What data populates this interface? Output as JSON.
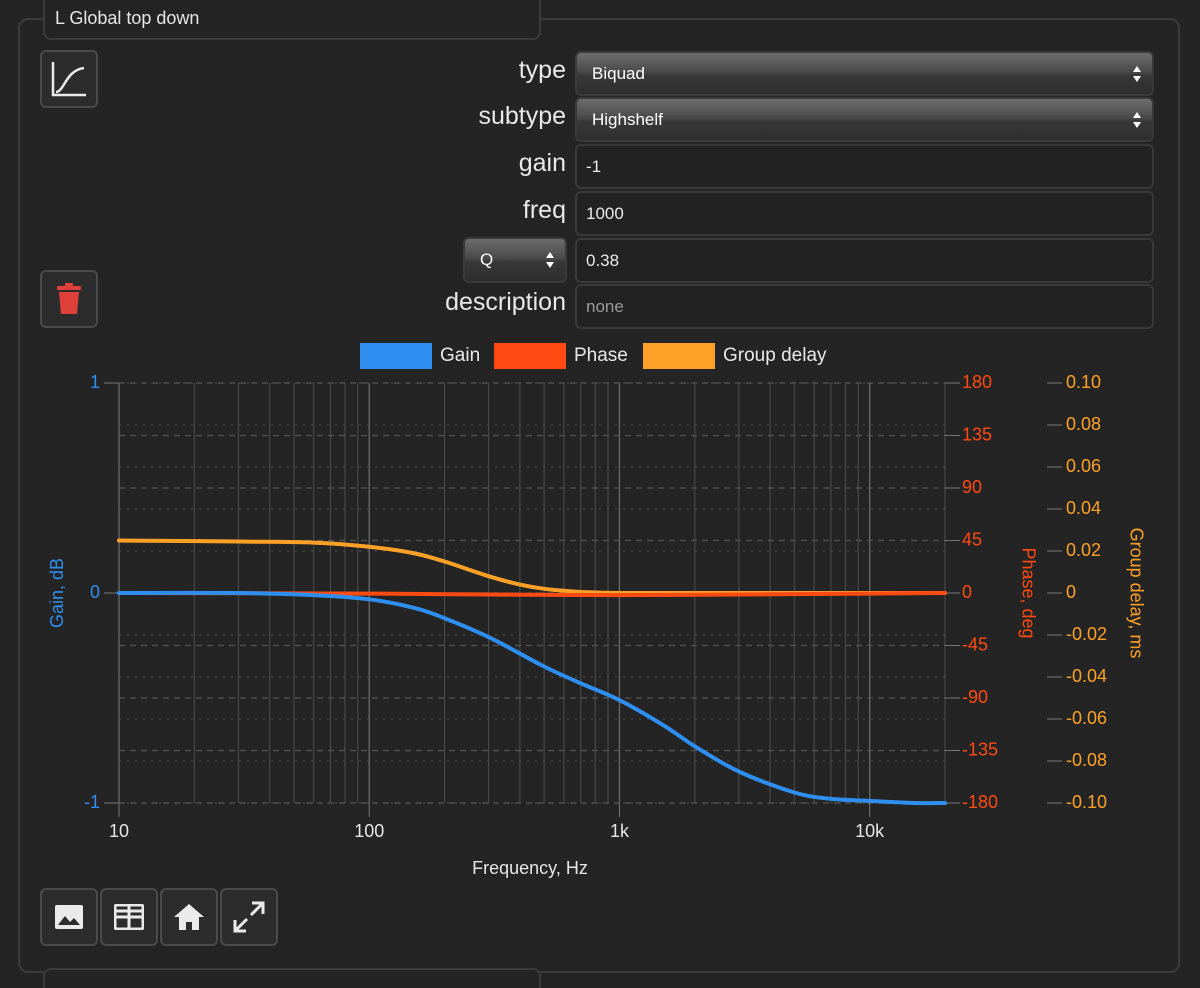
{
  "panel": {
    "title": "L Global top down"
  },
  "form": {
    "type_label": "type",
    "type_value": "Biquad",
    "subtype_label": "subtype",
    "subtype_value": "Highshelf",
    "gain_label": "gain",
    "gain_value": "-1",
    "freq_label": "freq",
    "freq_value": "1000",
    "q_select_value": "Q",
    "q_value": "0.38",
    "description_label": "description",
    "description_value": "none"
  },
  "icons": {
    "plot_button": "line-chart-icon",
    "delete_button": "trash-icon",
    "save_image": "image-icon",
    "table": "table-icon",
    "home": "home-icon",
    "expand": "expand-icon"
  },
  "colors": {
    "gain": "#2f8ff0",
    "phase": "#ff4a12",
    "group_delay": "#ffa126",
    "delete": "#e0403a"
  },
  "chart_data": {
    "type": "line",
    "xlabel": "Frequency, Hz",
    "ylabel_left": "Gain, dB",
    "ylabel_right": "Phase, deg",
    "ylabel_right2": "Group delay, ms",
    "xscale": "log",
    "xlim": [
      10,
      20000
    ],
    "x_ticks": [
      "10",
      "100",
      "1k",
      "10k"
    ],
    "gain_ylim": [
      -1,
      1
    ],
    "gain_ticks": [
      "1",
      "0",
      "-1"
    ],
    "phase_ylim": [
      -180,
      180
    ],
    "phase_ticks": [
      "180",
      "135",
      "90",
      "45",
      "0",
      "-45",
      "-90",
      "-135",
      "-180"
    ],
    "delay_ylim": [
      -0.1,
      0.1
    ],
    "delay_ticks": [
      "0.10",
      "0.08",
      "0.06",
      "0.04",
      "0.02",
      "0",
      "-0.02",
      "-0.04",
      "-0.06",
      "-0.08",
      "-0.10"
    ],
    "grid": true,
    "legend_position": "top",
    "series": [
      {
        "name": "Gain",
        "axis": "gain",
        "x": [
          10,
          30,
          60,
          100,
          150,
          200,
          300,
          500,
          700,
          1000,
          1500,
          2000,
          3000,
          5000,
          7000,
          10000,
          15000,
          20000
        ],
        "values": [
          0,
          0,
          -0.01,
          -0.03,
          -0.07,
          -0.12,
          -0.21,
          -0.35,
          -0.43,
          -0.51,
          -0.63,
          -0.73,
          -0.85,
          -0.95,
          -0.98,
          -0.99,
          -1.0,
          -1.0
        ]
      },
      {
        "name": "Phase",
        "axis": "phase",
        "x": [
          10,
          100,
          300,
          1000,
          3000,
          10000,
          20000
        ],
        "values": [
          0,
          -0.5,
          -1.3,
          -1.8,
          -1.3,
          -0.5,
          0
        ]
      },
      {
        "name": "Group delay",
        "axis": "delay",
        "x": [
          10,
          30,
          60,
          100,
          150,
          200,
          300,
          400,
          500,
          700,
          1000,
          3000,
          20000
        ],
        "values": [
          0.025,
          0.0245,
          0.024,
          0.022,
          0.019,
          0.015,
          0.008,
          0.004,
          0.002,
          0.0005,
          0,
          0,
          0
        ]
      }
    ]
  }
}
